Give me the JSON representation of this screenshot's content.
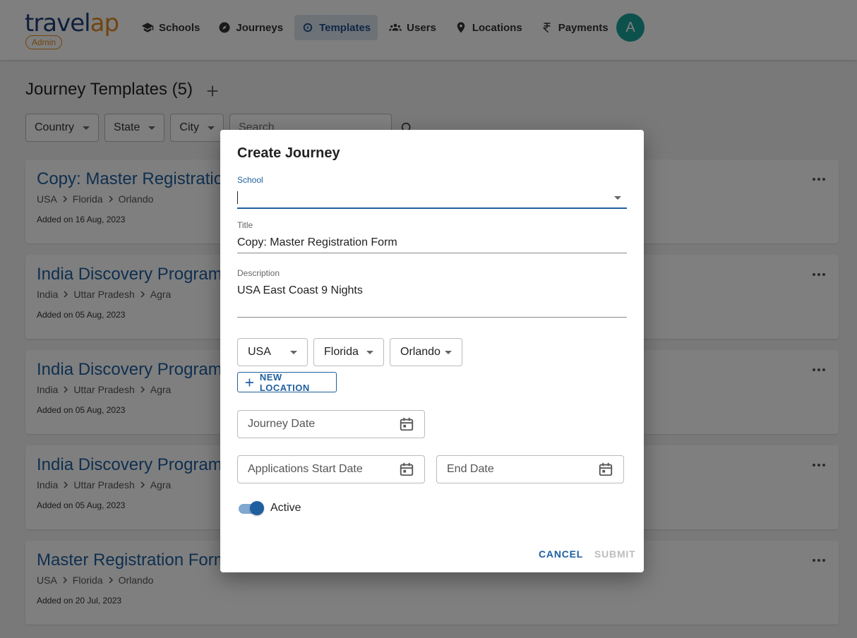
{
  "header": {
    "logo_main": "travel",
    "logo_accent": "ap",
    "admin_badge": "Admin",
    "nav": [
      {
        "label": "Schools",
        "icon": "school-icon"
      },
      {
        "label": "Journeys",
        "icon": "compass-icon"
      },
      {
        "label": "Templates",
        "icon": "templates-icon",
        "active": true
      },
      {
        "label": "Users",
        "icon": "users-icon"
      },
      {
        "label": "Locations",
        "icon": "location-pin-icon"
      },
      {
        "label": "Payments",
        "icon": "rupee-icon"
      }
    ],
    "avatar_initial": "A"
  },
  "page": {
    "title": "Journey Templates (5)",
    "filters": {
      "country": "Country",
      "state": "State",
      "city": "City",
      "search_placeholder": "Search"
    }
  },
  "templates": [
    {
      "title": "Copy: Master Registration Form",
      "path": [
        "USA",
        "Florida",
        "Orlando"
      ],
      "added": "Added on 16 Aug, 2023"
    },
    {
      "title": "India Discovery Program",
      "path": [
        "India",
        "Uttar Pradesh",
        "Agra"
      ],
      "added": "Added on 05 Aug, 2023"
    },
    {
      "title": "India Discovery Program",
      "path": [
        "India",
        "Uttar Pradesh",
        "Agra"
      ],
      "added": "Added on 05 Aug, 2023"
    },
    {
      "title": "India Discovery Program",
      "path": [
        "India",
        "Uttar Pradesh",
        "Agra"
      ],
      "added": "Added on 05 Aug, 2023"
    },
    {
      "title": "Master Registration Form",
      "path": [
        "USA",
        "Florida",
        "Orlando"
      ],
      "added": "Added on 20 Jul, 2023"
    }
  ],
  "dialog": {
    "title": "Create Journey",
    "school_label": "School",
    "school_value": "",
    "title_label": "Title",
    "title_value": "Copy: Master Registration Form",
    "description_label": "Description",
    "description_value": "USA East Coast 9 Nights",
    "country": "USA",
    "state": "Florida",
    "city": "Orlando",
    "new_location": "NEW LOCATION",
    "journey_date_placeholder": "Journey Date",
    "app_start_placeholder": "Applications Start Date",
    "end_date_placeholder": "End Date",
    "active_label": "Active",
    "active": true,
    "cancel": "CANCEL",
    "submit": "SUBMIT"
  },
  "colors": {
    "primary": "#1f5f9f",
    "accent": "#e08a1e",
    "avatar": "#1aa39a"
  }
}
